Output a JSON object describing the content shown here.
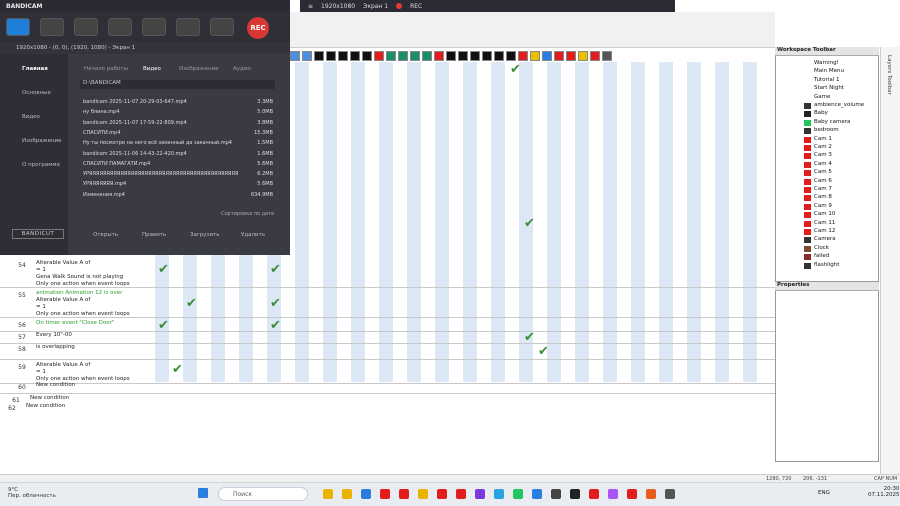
{
  "recorder_bar": {
    "resolution": "1920x1080",
    "screen": "Экран 1",
    "rec": "REC"
  },
  "grid": {
    "rows": [
      {
        "num": "54",
        "lines": [
          "Alterable Value A of",
          "= 1",
          "Gena Walk Sound is not playing",
          "Only one action when event loops"
        ]
      },
      {
        "num": "55",
        "lines": [
          "animation Animation 12 is over",
          "Alterable Value A of",
          "= 1",
          "Only one action when event loops"
        ]
      },
      {
        "num": "56",
        "lines": [
          "On timer event \"Close Door\""
        ]
      },
      {
        "num": "57",
        "lines": [
          "Every 10\"-00"
        ]
      },
      {
        "num": "58",
        "lines": [
          "is overlapping"
        ]
      },
      {
        "num": "59",
        "lines": [
          "Alterable Value A of",
          "= 1",
          "Only one action when event loops"
        ]
      },
      {
        "num": "60",
        "lines": [
          "New condition"
        ]
      },
      {
        "num": "61",
        "lines": [
          "New condition"
        ]
      },
      {
        "num": "62",
        "lines": [
          "New condition"
        ]
      }
    ]
  },
  "bandicam": {
    "title": "BANDICAM",
    "rec_label": "REC",
    "subtitle": "1920x1080 - (0, 0), (1920, 1080) - Экран 1",
    "sidebar": [
      "Главная",
      "Основные",
      "Видео",
      "Изображение",
      "О программе"
    ],
    "tabs": [
      "Начало работы",
      "Видео",
      "Изображение",
      "Аудио"
    ],
    "path": "D:\\BANDICAM",
    "files": [
      {
        "name": "bandicam 2025-11-07 20-29-03-647.mp4",
        "size": "3.3MB"
      },
      {
        "name": "ну блина.mp4",
        "size": "5.0MB"
      },
      {
        "name": "bandicam 2025-11-07 17-59-22-809.mp4",
        "size": "3.8MB"
      },
      {
        "name": "СПАСИТИ.mp4",
        "size": "15.3MB"
      },
      {
        "name": "Ну ты посмотри на него всё закинный да закачный.mp4",
        "size": "1.5MB"
      },
      {
        "name": "bandicam 2025-11-06 14-43-22-420.mp4",
        "size": "1.6MB"
      },
      {
        "name": "СПАСИТИ ПАМАГАТИ.mp4",
        "size": "5.6MB"
      },
      {
        "name": "УРЯЯЯЯЯЯЯЯЯЯЯЯЯЯЯЯЯЯЯЯЯЯЯЯЯЯЯЯЯЯЯЯЯЯЯЯЯЯЯЯЯЯЯЯЯЯЯ",
        "size": "6.2MB"
      },
      {
        "name": "УРЯЯЯЯЯЯЯ.mp4",
        "size": "5.6MB"
      },
      {
        "name": "Изменения.mp4",
        "size": "634.9MB"
      }
    ],
    "sort_label": "Сортировка по дате",
    "actions": [
      "Открыть",
      "Править",
      "Загрузить",
      "Удалить"
    ],
    "bandicut": "BANDICUT"
  },
  "workspace": {
    "title": "Workspace Toolbar",
    "items": [
      {
        "label": "Warning!",
        "color": "#ffffff"
      },
      {
        "label": "Main Menu",
        "color": "#ffffff"
      },
      {
        "label": "Tutorial 1",
        "color": "#ffffff"
      },
      {
        "label": "Start Night",
        "color": "#ffffff"
      },
      {
        "label": "Game",
        "color": "#ffffff"
      },
      {
        "label": "ambience_volume",
        "color": "#333333"
      },
      {
        "label": "Baby",
        "color": "#222222"
      },
      {
        "label": "Baby camera",
        "color": "#22c55e"
      },
      {
        "label": "bedroom",
        "color": "#333333"
      },
      {
        "label": "Cam 1",
        "color": "#e11d1d"
      },
      {
        "label": "Cam 2",
        "color": "#e11d1d"
      },
      {
        "label": "Cam 3",
        "color": "#e11d1d"
      },
      {
        "label": "Cam 4",
        "color": "#e11d1d"
      },
      {
        "label": "Cam 5",
        "color": "#e11d1d"
      },
      {
        "label": "Cam 6",
        "color": "#e11d1d"
      },
      {
        "label": "Cam 7",
        "color": "#e11d1d"
      },
      {
        "label": "Cam 8",
        "color": "#e11d1d"
      },
      {
        "label": "Cam 9",
        "color": "#e11d1d"
      },
      {
        "label": "Cam 10",
        "color": "#e11d1d"
      },
      {
        "label": "Cam 11",
        "color": "#e11d1d"
      },
      {
        "label": "Cam 12",
        "color": "#e11d1d"
      },
      {
        "label": "Camera",
        "color": "#333333"
      },
      {
        "label": "Clock",
        "color": "#7a4b2a"
      },
      {
        "label": "failed",
        "color": "#8b2a2a"
      },
      {
        "label": "flashlight",
        "color": "#333333"
      }
    ],
    "properties_title": "Properties",
    "side_tab": "Layers Toolbar"
  },
  "status": {
    "coords": "1280, 720",
    "mouse": "206, -131",
    "flags": "CAP NUM"
  },
  "taskbar": {
    "temp": "9°C",
    "weather": "Пер. облачность",
    "search": "Поиск",
    "lang": "ENG",
    "time": "20:30",
    "date": "07.11.2025"
  }
}
